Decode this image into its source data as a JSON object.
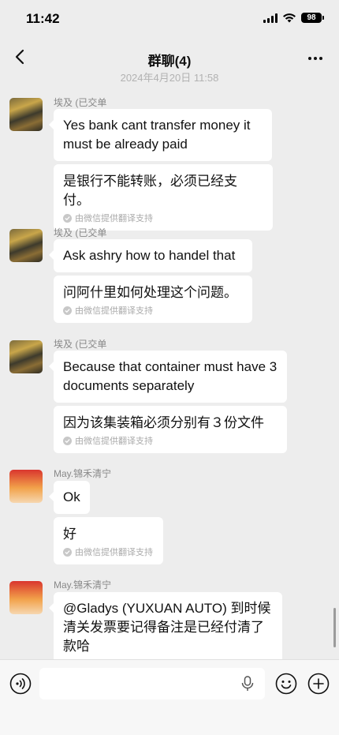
{
  "status": {
    "time": "11:42",
    "battery": "98"
  },
  "nav": {
    "title": "群聊(4)"
  },
  "timestamp": "2024年4月20日 11:58",
  "translation_note": "由微信提供翻译支持",
  "messages": [
    {
      "sender": "埃及 (已交单",
      "text": "Yes bank cant transfer money it must be already paid",
      "translation": "是银行不能转账，必须已经支付。"
    },
    {
      "sender": "埃及 (已交单",
      "text": "Ask ashry how to handel that",
      "translation": "问阿什里如何处理这个问题。"
    },
    {
      "sender": "埃及 (已交单",
      "text": "Because that container must have 3 documents separately",
      "translation": "因为该集装箱必须分别有３份文件"
    },
    {
      "sender": "May.锦禾清宁",
      "text": "Ok",
      "translation": "好"
    },
    {
      "sender": "May.锦禾清宁",
      "text": "@Gladys (YUXUAN AUTO) 到时候清关发票要记得备注是已经付清了款哈"
    }
  ]
}
